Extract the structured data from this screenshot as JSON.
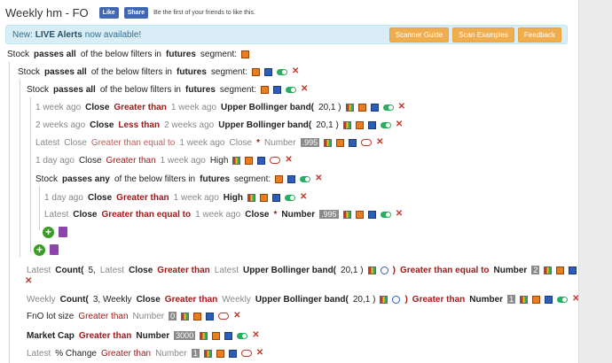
{
  "header": {
    "title": "Weekly hm - FO",
    "like": "Like",
    "share": "Share",
    "fb_text": "Be the first of your friends to like this."
  },
  "alert": {
    "new": "New:",
    "live": "LIVE Alerts",
    "rest": "now available!",
    "buttons": [
      "Scanner Guide",
      "Scan Examples",
      "Feedback"
    ]
  },
  "words": {
    "stock": "Stock",
    "passes_all": "passes all",
    "passes_any": "passes any",
    "of_the": "of the below filters in",
    "futures": "futures",
    "segment": "segment:",
    "close": "Close",
    "greater_than": "Greater than",
    "less_than": "Less than",
    "gte": "Greater than equal to",
    "high": "High",
    "latest": "Latest",
    "number": "Number",
    "upper_bb": "Upper Bollinger band(",
    "star": "*",
    "count": "Count("
  },
  "rows": {
    "r1_a": "1 week ago",
    "r1_b": "1 week ago",
    "r1_args": "20,1 )",
    "r2_a": "2 weeks ago",
    "r2_b": "2 weeks ago",
    "r2_args": "20,1 )",
    "r3_b": "1 week ago",
    "r3_num": ".995",
    "r4_a": "1 day ago",
    "r4_b": "1 week ago",
    "r5_a": "1 day ago",
    "r5_b": "1 week ago",
    "r6_b": "1 week ago",
    "r6_num": ".995",
    "r7_count": "5,",
    "r7_args": "20,1 )",
    "r7_num": "2",
    "r8_weekly": "Weekly",
    "r8_count": "3, Weekly",
    "r8_weekly2": "Weekly",
    "r8_args": "20,1 )",
    "r8_num": "1",
    "r9_label": "FnO lot size",
    "r9_num": "0",
    "r10_label": "Market Cap",
    "r10_num": "3000",
    "r11_label": "% Change",
    "r11_num": "1"
  }
}
